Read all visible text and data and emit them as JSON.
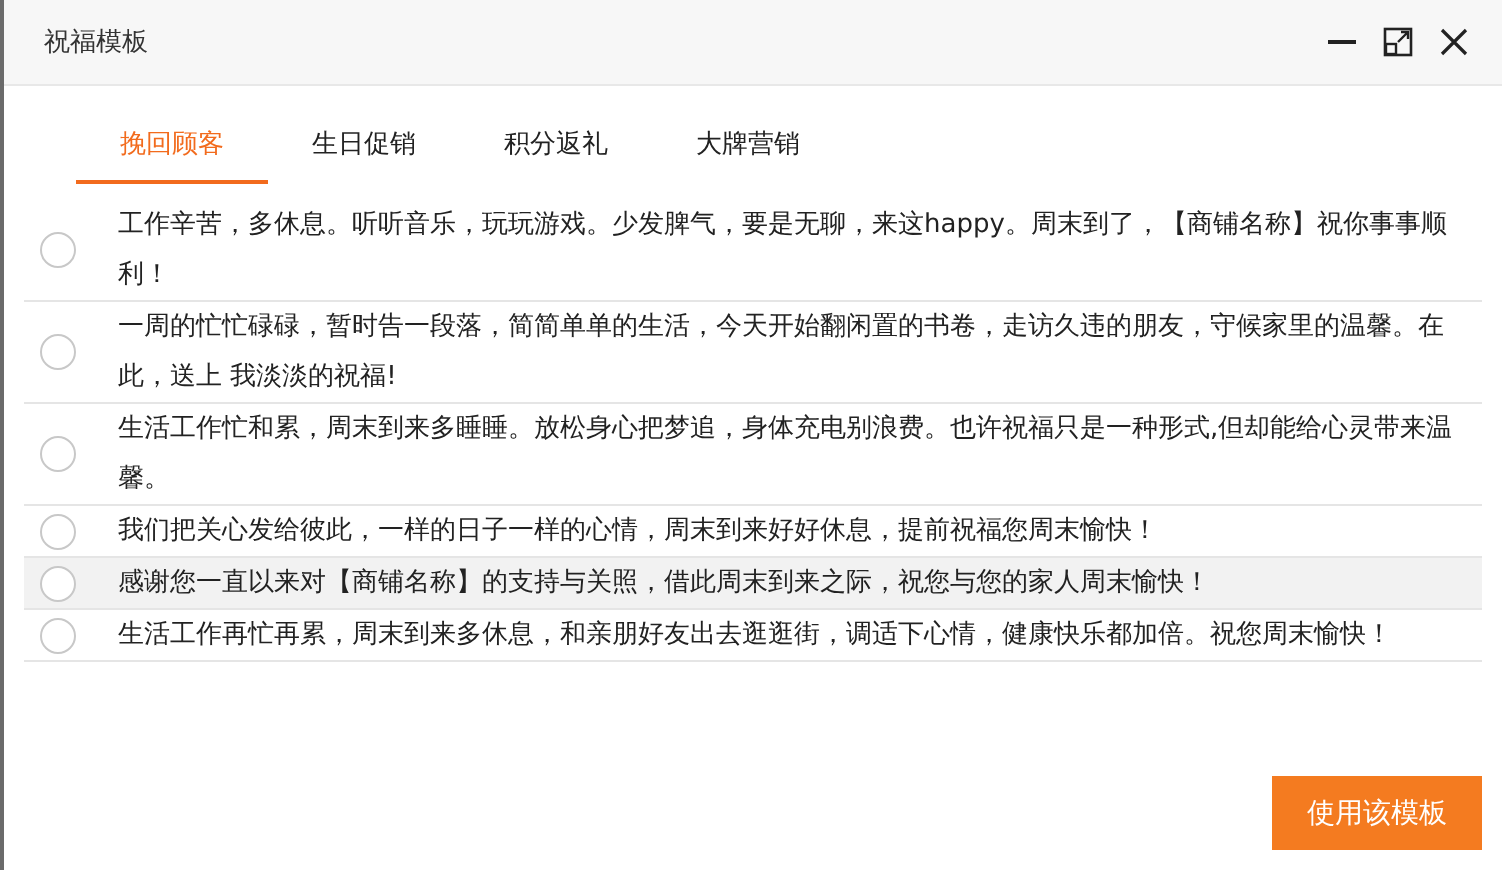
{
  "window": {
    "title": "祝福模板"
  },
  "tabs": [
    {
      "label": "挽回顾客",
      "selected": true
    },
    {
      "label": "生日促销",
      "selected": false
    },
    {
      "label": "积分返礼",
      "selected": false
    },
    {
      "label": "大牌营销",
      "selected": false
    }
  ],
  "templates": [
    {
      "text": "工作辛苦，多休息。听听音乐，玩玩游戏。少发脾气，要是无聊，来这happy。周末到了，【商铺名称】祝你事事顺利！",
      "selected": false,
      "highlighted": false
    },
    {
      "text": "一周的忙忙碌碌，暂时告一段落，简简单单的生活，今天开始翻闲置的书卷，走访久违的朋友，守候家里的温馨。在此，送上 我淡淡的祝福!",
      "selected": false,
      "highlighted": false
    },
    {
      "text": "生活工作忙和累，周末到来多睡睡。放松身心把梦追，身体充电别浪费。也许祝福只是一种形式,但却能给心灵带来温馨。",
      "selected": false,
      "highlighted": false
    },
    {
      "text": "我们把关心发给彼此，一样的日子一样的心情，周末到来好好休息，提前祝福您周末愉快！",
      "selected": false,
      "highlighted": false
    },
    {
      "text": "感谢您一直以来对【商铺名称】的支持与关照，借此周末到来之际，祝您与您的家人周末愉快！",
      "selected": false,
      "highlighted": true
    },
    {
      "text": "生活工作再忙再累，周末到来多休息，和亲朋好友出去逛逛街，调适下心情，健康快乐都加倍。祝您周末愉快！",
      "selected": false,
      "highlighted": false
    }
  ],
  "button": {
    "label": "使用该模板"
  }
}
